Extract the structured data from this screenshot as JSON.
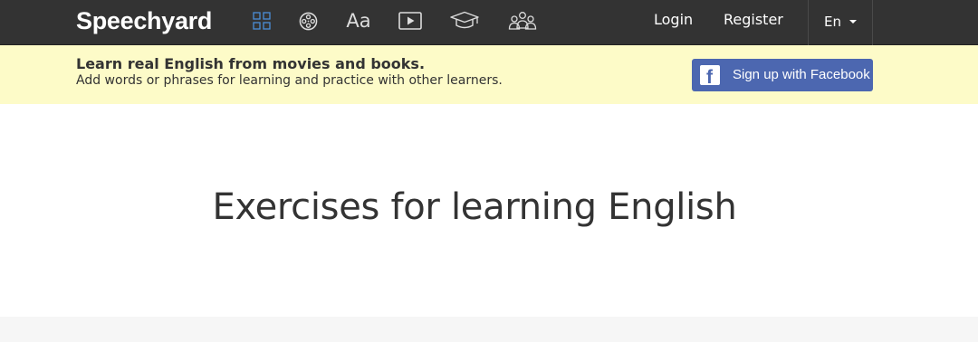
{
  "navbar": {
    "logo": "Speechyard",
    "icons": [
      {
        "name": "grid-icon",
        "color": "#4a8fd8",
        "active": true
      },
      {
        "name": "film-reel-icon",
        "color": "#dddddd"
      },
      {
        "name": "font-aa-icon",
        "label": "Aa",
        "color": "#dddddd"
      },
      {
        "name": "play-video-icon",
        "color": "#dddddd"
      },
      {
        "name": "graduation-cap-icon",
        "color": "#dddddd"
      },
      {
        "name": "users-group-icon",
        "color": "#dddddd"
      }
    ],
    "login_label": "Login",
    "register_label": "Register",
    "language": "En",
    "background": "#333333"
  },
  "banner": {
    "title": "Learn real English from movies and books.",
    "subtitle": "Add words or phrases for learning and practice with other learners.",
    "facebook_button_label": "Sign up with Facebook",
    "facebook_icon": "facebook-icon",
    "facebook_color": "#4c67b0",
    "background": "#fdfbc8"
  },
  "main": {
    "title": "Exercises for learning English"
  }
}
